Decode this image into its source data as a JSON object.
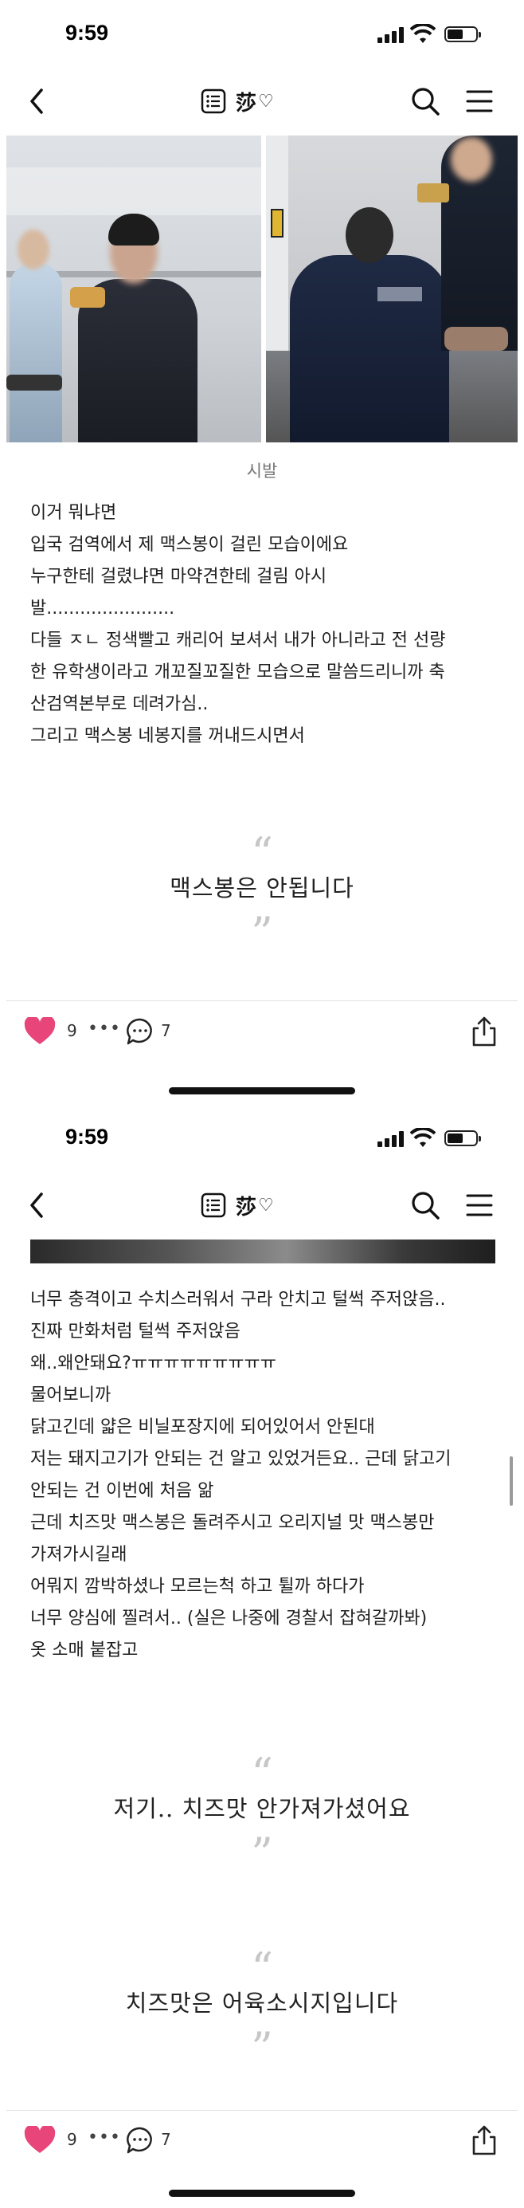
{
  "screens": [
    {
      "status": {
        "time": "9:59"
      },
      "nav": {
        "title": "莎"
      },
      "photos": [
        {
          "kind": "photo",
          "subject": "customs-inspection-left"
        },
        {
          "kind": "photo",
          "subject": "quarantine-officer-right"
        }
      ],
      "caption": "시발",
      "body": [
        "이거 뭐냐면",
        "입국 검역에서 제 맥스봉이 걸린 모습이에요",
        "누구한테 걸렸냐면 마약견한테 걸림 아시",
        "발.......................",
        "다들 ㅈㄴ 정색빨고 캐리어 보셔서 내가 아니라고 전 선량",
        "한 유학생이라고 개꼬질꼬질한 모습으로 말씀드리니까 축",
        "산검역본부로 데려가심..",
        "그리고 맥스봉 네봉지를 꺼내드시면서"
      ],
      "quotes": [
        "맥스봉은 안됩니다"
      ],
      "actions": {
        "likes": "9",
        "more": "•••",
        "comments": "7"
      }
    },
    {
      "status": {
        "time": "9:59"
      },
      "nav": {
        "title": "莎"
      },
      "body": [
        "너무 충격이고 수치스러워서 구라 안치고 털썩 주저앉음..",
        "진짜 만화처럼 털썩 주저앉음",
        "왜..왜안돼요?ㅠㅠㅠㅠㅠㅠㅠㅠㅠ",
        "물어보니까",
        "닭고긴데 얇은 비닐포장지에 되어있어서 안된대",
        "저는 돼지고기가 안되는 건 알고 있었거든요.. 근데 닭고기",
        "안되는 건 이번에 처음 앎",
        "근데 치즈맛 맥스봉은 돌려주시고 오리지널 맛 맥스봉만",
        "가져가시길래",
        "어뭐지 깜박하셨나 모르는척 하고 튈까 하다가",
        "너무 양심에 찔려서.. (실은 나중에 경찰서 잡혀갈까봐)",
        "옷 소매 붙잡고"
      ],
      "quotes": [
        "저기.. 치즈맛 안가져가셨어요",
        "치즈맛은 어육소시지입니다"
      ],
      "actions": {
        "likes": "9",
        "more": "•••",
        "comments": "7"
      }
    }
  ],
  "colors": {
    "heart": "#e8457a",
    "quote_mark": "#c6c6c6",
    "caption": "#777777"
  },
  "icons": [
    "back-arrow-icon",
    "list-menu-icon",
    "heart-outline-icon",
    "search-icon",
    "hamburger-menu-icon",
    "heart-filled-icon",
    "comment-icon",
    "share-icon",
    "signal-icon",
    "wifi-icon",
    "battery-icon"
  ]
}
